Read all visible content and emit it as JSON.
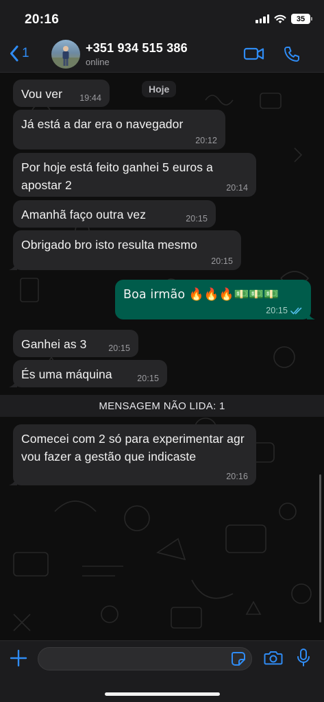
{
  "status_bar": {
    "time": "20:16",
    "battery": "35"
  },
  "header": {
    "back_count": "1",
    "contact_name": "+351 934 515 386",
    "contact_status": "online"
  },
  "chat": {
    "day_label": "Hoje",
    "unread_label": "MENSAGEM NÃO LIDA: 1",
    "messages": [
      {
        "dir": "in",
        "text": "Vou ver",
        "time": "19:44"
      },
      {
        "dir": "in",
        "text": "Já está a dar era o navegador",
        "time": "20:12"
      },
      {
        "dir": "in",
        "text": "Por hoje está feito ganhei 5 euros a apostar 2",
        "time": "20:14"
      },
      {
        "dir": "in",
        "text": "Amanhã faço outra vez",
        "time": "20:15"
      },
      {
        "dir": "in",
        "text": "Obrigado bro isto resulta mesmo",
        "time": "20:15"
      },
      {
        "dir": "out",
        "text": "Boa irmão 🔥🔥🔥💵💵💵",
        "time": "20:15",
        "status": "read"
      },
      {
        "dir": "in",
        "text": "Ganhei as 3",
        "time": "20:15"
      },
      {
        "dir": "in",
        "text": "És uma máquina",
        "time": "20:15"
      },
      {
        "dir": "in",
        "text": "Comecei com 2 só para experimentar agr vou fazer a gestão que indicaste",
        "time": "20:16"
      }
    ]
  },
  "composer": {
    "placeholder": ""
  },
  "colors": {
    "accent": "#2f8cf5",
    "incoming": "#262628",
    "outgoing": "#005c4b",
    "background": "#0e0e0e"
  }
}
